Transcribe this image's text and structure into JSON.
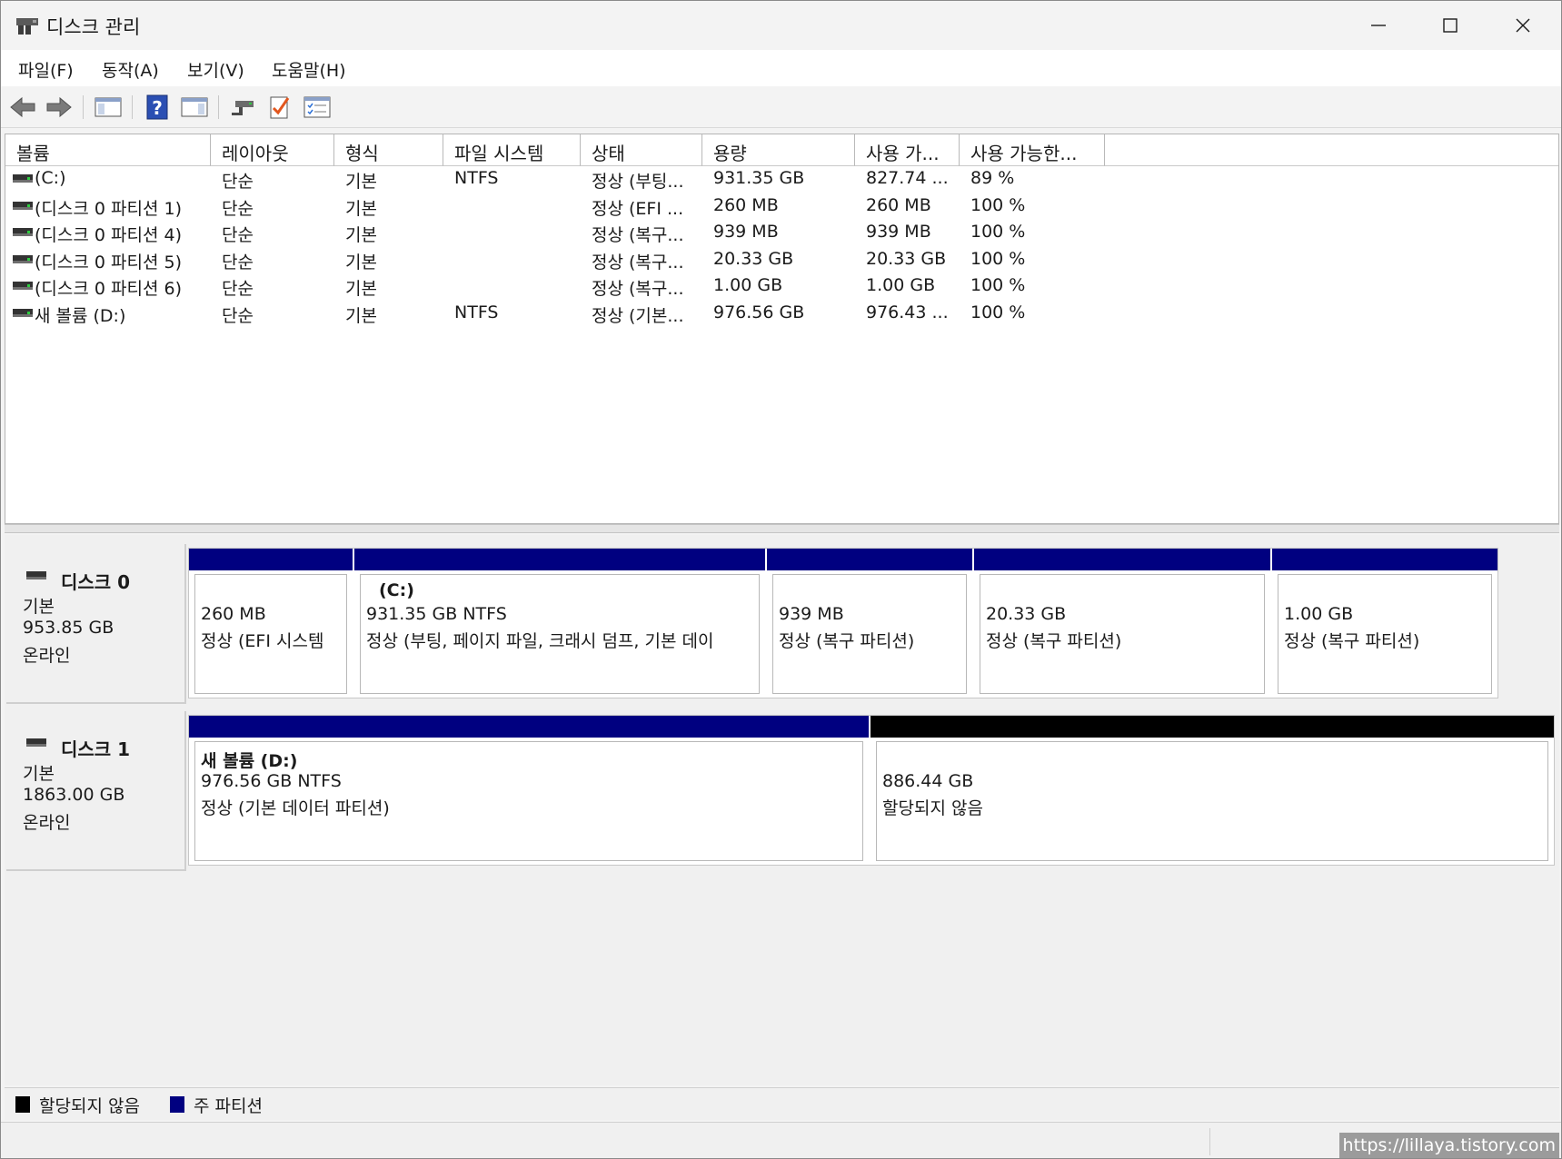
{
  "window": {
    "title": "디스크 관리",
    "controls": {
      "minimize": "minimize-icon",
      "maximize": "maximize-icon",
      "close": "close-icon"
    }
  },
  "menu": [
    "파일(F)",
    "동작(A)",
    "보기(V)",
    "도움말(H)"
  ],
  "toolbar": {
    "icons": [
      "back-arrow-icon",
      "forward-arrow-icon",
      "show-hide-console-tree-icon",
      "help-icon",
      "show-hide-action-pane-icon",
      "connect-icon",
      "checklist-icon",
      "properties-icon"
    ]
  },
  "volumes": {
    "columns": [
      "볼륨",
      "레이아웃",
      "형식",
      "파일 시스템",
      "상태",
      "용량",
      "사용 가...",
      "사용 가능한..."
    ],
    "rows": [
      [
        "(C:)",
        "단순",
        "기본",
        "NTFS",
        "정상 (부팅...",
        "931.35 GB",
        "827.74 ...",
        "89 %"
      ],
      [
        "(디스크 0 파티션 1)",
        "단순",
        "기본",
        "",
        "정상 (EFI ...",
        "260 MB",
        "260 MB",
        "100 %"
      ],
      [
        "(디스크 0 파티션 4)",
        "단순",
        "기본",
        "",
        "정상 (복구...",
        "939 MB",
        "939 MB",
        "100 %"
      ],
      [
        "(디스크 0 파티션 5)",
        "단순",
        "기본",
        "",
        "정상 (복구...",
        "20.33 GB",
        "20.33 GB",
        "100 %"
      ],
      [
        "(디스크 0 파티션 6)",
        "단순",
        "기본",
        "",
        "정상 (복구...",
        "1.00 GB",
        "1.00 GB",
        "100 %"
      ],
      [
        "새 볼륨 (D:)",
        "단순",
        "기본",
        "NTFS",
        "정상 (기본...",
        "976.56 GB",
        "976.43 ...",
        "100 %"
      ]
    ]
  },
  "disks": [
    {
      "name": "디스크 0",
      "type": "기본",
      "size": "953.85 GB",
      "state": "온라인",
      "partitions": [
        {
          "title": "",
          "line1": "260 MB",
          "line2": "정상 (EFI 시스템",
          "kind": "primary"
        },
        {
          "title": "(C:)",
          "line1": "931.35 GB NTFS",
          "line2": "정상 (부팅, 페이지 파일, 크래시 덤프, 기본 데이",
          "kind": "primary"
        },
        {
          "title": "",
          "line1": "939 MB",
          "line2": "정상 (복구 파티션)",
          "kind": "primary"
        },
        {
          "title": "",
          "line1": "20.33 GB",
          "line2": "정상 (복구 파티션)",
          "kind": "primary"
        },
        {
          "title": "",
          "line1": "1.00 GB",
          "line2": "정상 (복구 파티션)",
          "kind": "primary"
        }
      ]
    },
    {
      "name": "디스크 1",
      "type": "기본",
      "size": "1863.00 GB",
      "state": "온라인",
      "partitions": [
        {
          "title": "새 볼륨  (D:)",
          "line1": "976.56 GB NTFS",
          "line2": "정상 (기본 데이터 파티션)",
          "kind": "primary"
        },
        {
          "title": "",
          "line1": "886.44 GB",
          "line2": "할당되지 않음",
          "kind": "unallocated"
        }
      ]
    }
  ],
  "legend": {
    "unallocated": {
      "label": "할당되지 않음",
      "color": "#000000"
    },
    "primary": {
      "label": "주 파티션",
      "color": "#000080"
    }
  },
  "watermark": "https://lillaya.tistory.com"
}
